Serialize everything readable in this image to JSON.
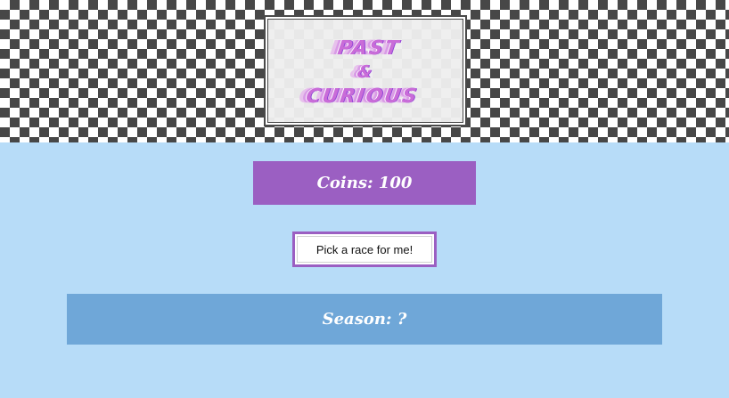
{
  "header": {
    "logo": {
      "line1": "PAST",
      "line2": "&",
      "line3": "CURIOUS"
    }
  },
  "stats": {
    "coins_label": "Coins: 100"
  },
  "actions": {
    "pick_race_label": "Pick a race for me!"
  },
  "season": {
    "label": "Season: ?"
  },
  "colors": {
    "checker_dark": "#474747",
    "page_bg": "#b7dcf8",
    "coins_bg": "#9b5fc2",
    "season_bg": "#6fa7d8",
    "button_border": "#9b5fc2",
    "logo_pink": "#c96cd8",
    "logo_purple": "#8f43d8"
  }
}
